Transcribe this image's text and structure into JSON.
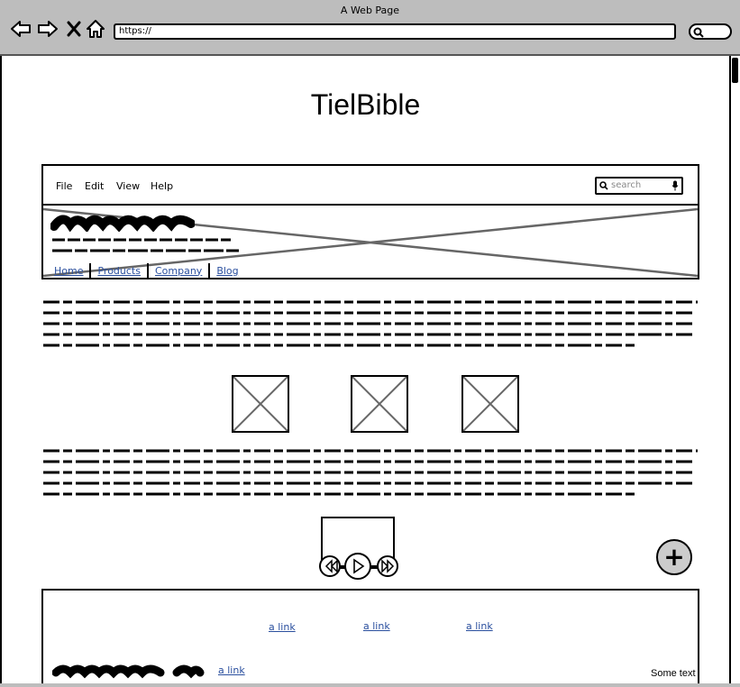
{
  "browser": {
    "window_title": "A Web Page",
    "url": "https://",
    "icons": [
      "back-arrow-icon",
      "forward-arrow-icon",
      "close-x-icon",
      "home-icon",
      "search-icon"
    ]
  },
  "site": {
    "title": "TielBible"
  },
  "menu": {
    "items": [
      "File",
      "Edit",
      "View",
      "Help"
    ],
    "search_placeholder": "search"
  },
  "nav": {
    "links": [
      "Home",
      "Products",
      "Company",
      "Blog"
    ]
  },
  "footer": {
    "links": [
      "a link",
      "a link",
      "a link",
      "a link"
    ],
    "some_text": "Some text"
  },
  "colors": {
    "chrome": "#bdbdbd",
    "link": "#2a4f9e",
    "button_fill": "#cccccc"
  }
}
